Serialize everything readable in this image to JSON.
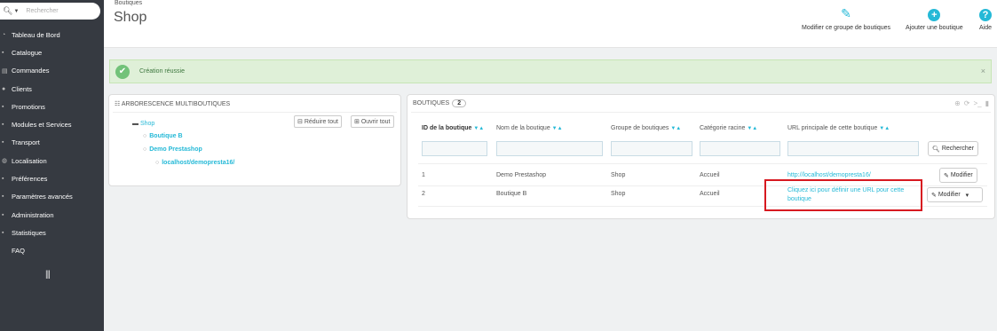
{
  "sidebar": {
    "search_placeholder": "Rechercher",
    "items": [
      {
        "label": "Tableau de Bord",
        "icon": "dashboard-icon"
      },
      {
        "label": "Catalogue",
        "icon": "catalog-icon"
      },
      {
        "label": "Commandes",
        "icon": "orders-icon"
      },
      {
        "label": "Clients",
        "icon": "customers-icon"
      },
      {
        "label": "Promotions",
        "icon": "promotions-icon"
      },
      {
        "label": "Modules et Services",
        "icon": "modules-icon"
      },
      {
        "label": "Transport",
        "icon": "transport-icon"
      },
      {
        "label": "Localisation",
        "icon": "localisation-icon"
      },
      {
        "label": "Préférences",
        "icon": "preferences-icon"
      },
      {
        "label": "Paramètres avancés",
        "icon": "advanced-settings-icon"
      },
      {
        "label": "Administration",
        "icon": "administration-icon"
      },
      {
        "label": "Statistiques",
        "icon": "stats-icon"
      },
      {
        "label": "FAQ",
        "icon": "faq-icon"
      }
    ]
  },
  "header": {
    "breadcrumb": "Boutiques",
    "title": "Shop",
    "toolbar": {
      "edit_group": "Modifier ce groupe de boutiques",
      "add_shop": "Ajouter une boutique",
      "help": "Aide"
    }
  },
  "alert": {
    "message": "Création réussie",
    "close": "×"
  },
  "tree": {
    "title": "ARBORESCENCE MULTIBOUTIQUES",
    "collapse_all": "Réduire tout",
    "expand_all": "Ouvrir tout",
    "root": "Shop",
    "nodes": [
      "Boutique B",
      "Demo Prestashop",
      "localhost/demopresta16/"
    ]
  },
  "shops": {
    "title": "BOUTIQUES",
    "count": "2",
    "columns": [
      "ID de la boutique",
      "Nom de la boutique",
      "Groupe de boutiques",
      "Catégorie racine",
      "URL principale de cette boutique"
    ],
    "search_button": "Rechercher",
    "rows": [
      {
        "id": "1",
        "name": "Demo Prestashop",
        "group": "Shop",
        "category": "Accueil",
        "url": "http://localhost/demopresta16/",
        "action": "Modifier"
      },
      {
        "id": "2",
        "name": "Boutique B",
        "group": "Shop",
        "category": "Accueil",
        "url": "Cliquez ici pour définir une URL pour cette boutique",
        "action": "Modifier"
      }
    ]
  },
  "colors": {
    "accent": "#25b9d7",
    "sidebar_bg": "#363a41",
    "success_bg": "#dff0d8",
    "highlight_border": "#d71920"
  }
}
